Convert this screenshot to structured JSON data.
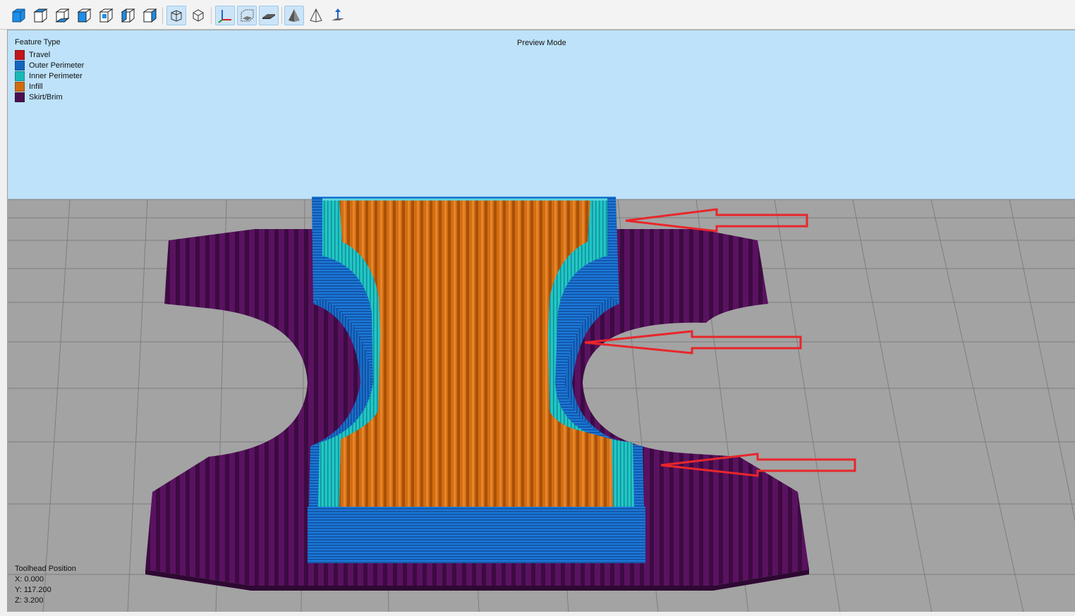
{
  "toolbar": {
    "buttons": [
      {
        "name": "view-iso-icon",
        "active": false
      },
      {
        "name": "view-top-icon",
        "active": false
      },
      {
        "name": "view-bottom-icon",
        "active": false
      },
      {
        "name": "view-front-icon",
        "active": false
      },
      {
        "name": "view-back-icon",
        "active": false
      },
      {
        "name": "view-left-icon",
        "active": false
      },
      {
        "name": "view-right-icon",
        "active": false
      },
      {
        "name": "perspective-icon",
        "active": true
      },
      {
        "name": "orthographic-icon",
        "active": false
      },
      {
        "name": "axes-icon",
        "active": true
      },
      {
        "name": "bounding-box-icon",
        "active": true
      },
      {
        "name": "build-plate-icon",
        "active": true
      },
      {
        "name": "solid-render-icon",
        "active": true
      },
      {
        "name": "wireframe-render-icon",
        "active": false
      },
      {
        "name": "set-origin-icon",
        "active": false
      }
    ]
  },
  "viewport": {
    "mode_label": "Preview Mode",
    "legend": {
      "title": "Feature Type",
      "items": [
        {
          "label": "Travel",
          "color": "#c0161c"
        },
        {
          "label": "Outer Perimeter",
          "color": "#1565c0"
        },
        {
          "label": "Inner Perimeter",
          "color": "#1cb8b8"
        },
        {
          "label": "Infill",
          "color": "#d06c10"
        },
        {
          "label": "Skirt/Brim",
          "color": "#4a1050"
        }
      ]
    },
    "toolhead": {
      "title": "Toolhead Position",
      "x": "X: 0.000",
      "y": "Y: 117.200",
      "z": "Z: 3.200"
    },
    "colors": {
      "sky": "#bde2fa",
      "plate": "#a3a3a3",
      "grid": "#7e7e7e",
      "annotation_arrow": "#e8262a"
    }
  }
}
